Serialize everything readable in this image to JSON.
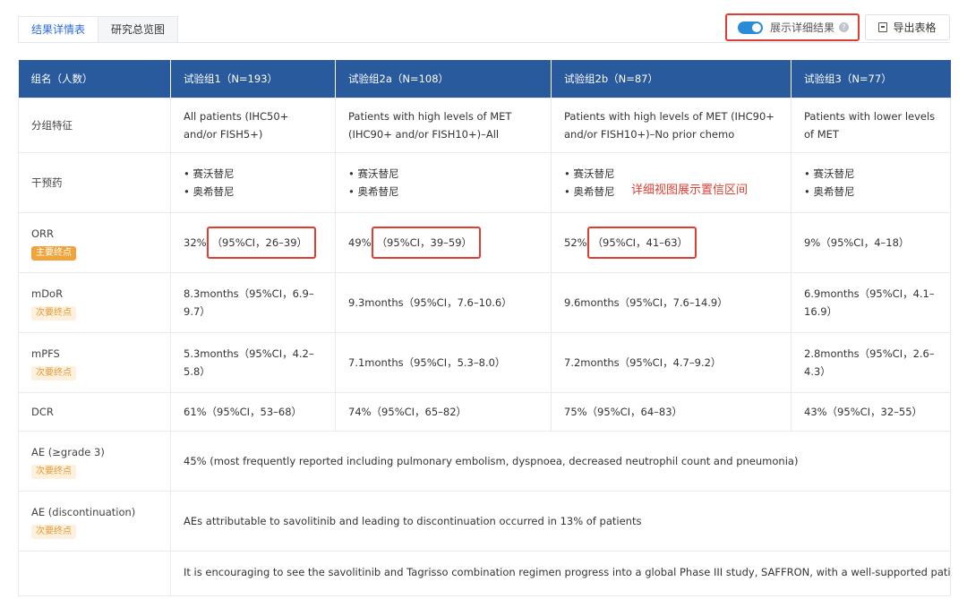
{
  "tabs": [
    {
      "label": "结果详情表",
      "active": true
    },
    {
      "label": "研究总览图",
      "active": false
    }
  ],
  "toolbar": {
    "toggle_label": "展示详细结果",
    "toggle_on": true,
    "export_label": "导出表格"
  },
  "annotation": "详细视图展示置信区间",
  "table": {
    "headers": [
      "组名（人数）",
      "试验组1（N=193）",
      "试验组2a（N=108）",
      "试验组2b（N=87）",
      "试验组3（N=77）"
    ],
    "rows": {
      "feature": {
        "label": "分组特征",
        "cells": [
          "All patients (IHC50+ and/or FISH5+)",
          "Patients with high levels of MET (IHC90+ and/or FISH10+)–All",
          "Patients with high levels of MET (IHC90+ and/or FISH10+)–No prior chemo",
          "Patients with lower levels of MET"
        ]
      },
      "drug": {
        "label": "干预药",
        "items": [
          "赛沃替尼",
          "奥希替尼"
        ]
      },
      "orr": {
        "label": "ORR",
        "tag": "主要终点",
        "cells": [
          {
            "value": "32%",
            "ci": "（95%CI，26–39）"
          },
          {
            "value": "49%",
            "ci": "（95%CI，39–59）"
          },
          {
            "value": "52%",
            "ci": "（95%CI，41–63）"
          },
          {
            "value": "9%",
            "ci": "（95%CI，4–18）"
          }
        ]
      },
      "mdor": {
        "label": "mDoR",
        "tag": "次要终点",
        "cells": [
          "8.3months（95%CI，6.9–9.7）",
          "9.3months（95%CI，7.6–10.6）",
          "9.6months（95%CI，7.6–14.9）",
          "6.9months（95%CI，4.1–16.9）"
        ]
      },
      "mpfs": {
        "label": "mPFS",
        "tag": "次要终点",
        "cells": [
          "5.3months（95%CI，4.2–5.8）",
          "7.1months（95%CI，5.3–8.0）",
          "7.2months（95%CI，4.7–9.2）",
          "2.8months（95%CI，2.6–4.3）"
        ]
      },
      "dcr": {
        "label": "DCR",
        "cells": [
          "61%（95%CI，53–68）",
          "74%（95%CI，65–82）",
          "75%（95%CI，64–83）",
          "43%（95%CI，32–55）"
        ]
      },
      "ae3": {
        "label": "AE (≥grade 3)",
        "tag": "次要终点",
        "text": "45% (most frequently reported including pulmonary embolism, dyspnoea, decreased neutrophil count and pneumonia)"
      },
      "aed": {
        "label": "AE (discontinuation)",
        "tag": "次要终点",
        "text": "AEs attributable to savolitinib and leading to discontinuation occurred in 13% of patients"
      },
      "note": {
        "label": "",
        "text": "It is encouraging to see the savolitinib and Tagrisso combination regimen progress into a global Phase III study, SAFFRON, with a well-supported patient"
      }
    }
  },
  "colors": {
    "header_bg": "#2a5a9e",
    "highlight": "#e03c31",
    "primary_tag": "#f0a43a",
    "accent": "#2c6bd6"
  }
}
